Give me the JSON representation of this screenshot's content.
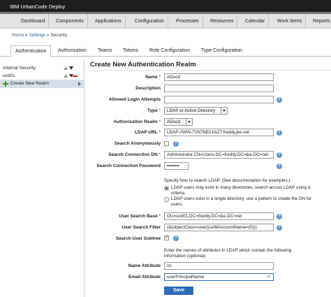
{
  "app": {
    "title": "IBM UrbanCode Deploy"
  },
  "nav": [
    "Dashboard",
    "Components",
    "Applications",
    "Configuration",
    "Processes",
    "Resources",
    "Calendar",
    "Work Items",
    "Reports"
  ],
  "breadcrumb": {
    "home": "Home",
    "sep1": "»",
    "settings": "Settings",
    "sep2": "»",
    "current": "Security"
  },
  "tabs": [
    "Authentication",
    "Authorization",
    "Teams",
    "Tokens",
    "Role Configuration",
    "Type Configuration"
  ],
  "sidebar": {
    "items": [
      {
        "label": "Internal Security"
      },
      {
        "label": "ucd01"
      },
      {
        "label": "Create New Realm"
      }
    ]
  },
  "form": {
    "heading": "Create New Authentication Realm",
    "name": {
      "label": "Name",
      "value": "ADucd"
    },
    "description": {
      "label": "Description",
      "value": ""
    },
    "allowed_login": {
      "label": "Allowed Login Attempts",
      "value": ""
    },
    "type": {
      "label": "Type",
      "value": "LDAP or Active Directory"
    },
    "auth_realm": {
      "label": "Authorization Realm",
      "value": "ADucd"
    },
    "ldap_url": {
      "label": "LDAP URL",
      "value": "LDAP://WIN-7VN7MDUIA2T.freddy.jke.net"
    },
    "search_anon": {
      "label": "Search Anonymously"
    },
    "search_conn_dn": {
      "label": "Search Connection DN",
      "value": "Administrator,CN=Users,DC=freddy,DC=jke,DC=net"
    },
    "search_conn_pw": {
      "label": "Search Connection Password",
      "value": "••••••••"
    },
    "search_hint": "Specify how to search LDAP. (See documentation for examples.)",
    "radio1": "LDAP users may exist in many directories; search across LDAP using a criteria.",
    "radio2": "LDAP users exist in a single directory; use a pattern to create the DN for users.",
    "user_search_base": {
      "label": "User Search Base",
      "value": "OU=ucd01,DC=freddy,DC=jke,DC=net"
    },
    "user_search_filter": {
      "label": "User Search Filter",
      "value": "(&(objectClass=user)(sAMAccountName={0}))"
    },
    "user_search_subtree": {
      "label": "Search User Subtree"
    },
    "attr_hint": "Enter the names of attributes in LDAP which contain the following information (optional)",
    "name_attr": {
      "label": "Name Attribute",
      "value": "cn"
    },
    "email_attr": {
      "label": "Email Attribute",
      "value": "userPrincipalName"
    },
    "save": "Save"
  },
  "colors": {
    "primary": "#2c6bb7",
    "required": "#cc0000",
    "help": "#5b93cf",
    "topbar": "#1e1e1e"
  },
  "icons": [
    "arrow-up-icon",
    "arrow-down-icon",
    "remove-icon",
    "add-icon",
    "expand-icon",
    "help-icon",
    "dropdown-icon",
    "clear-icon"
  ]
}
